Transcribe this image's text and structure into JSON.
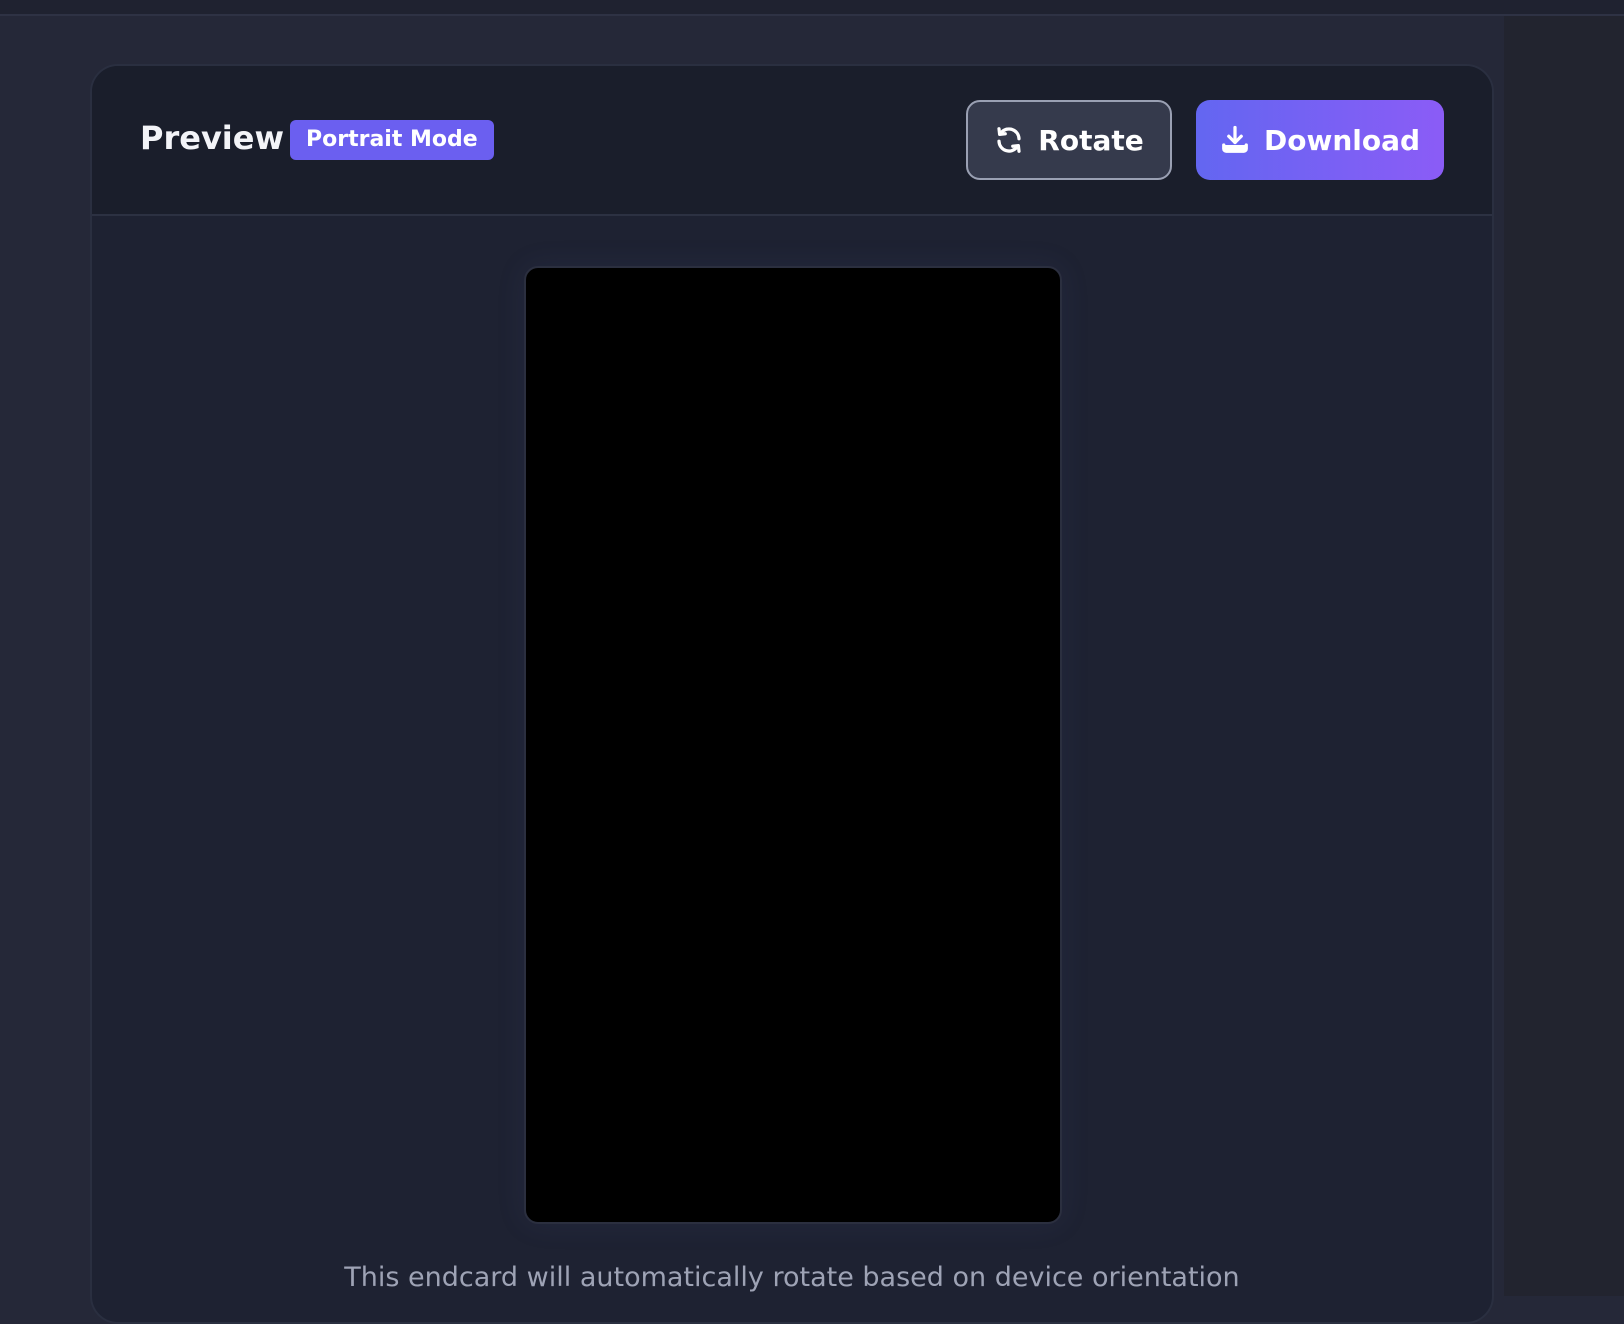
{
  "preview": {
    "title": "Preview",
    "mode_badge": "Portrait Mode",
    "note": "This endcard will automatically rotate based on device orientation"
  },
  "toolbar": {
    "rotate_label": "Rotate",
    "rotate_icon": "refresh-icon",
    "download_label": "Download",
    "download_icon": "download-icon"
  },
  "colors": {
    "accent": "#6366f1",
    "accent_end": "#8b5cf6",
    "badge": "#6b5ff0",
    "background": "#252838",
    "card": "#1e2232"
  }
}
